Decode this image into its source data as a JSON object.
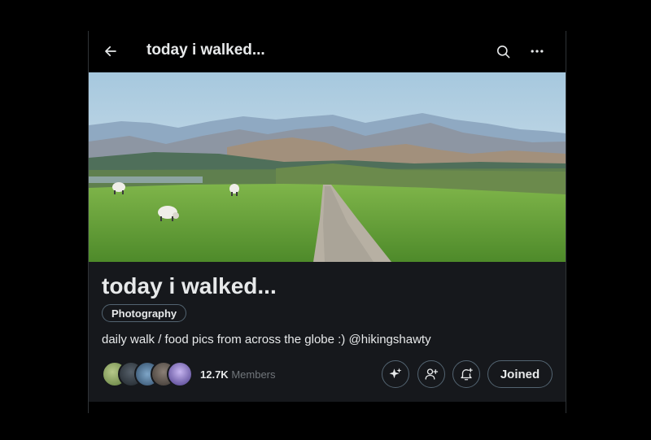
{
  "header": {
    "title": "today i walked...",
    "icons": {
      "back": "arrow-left-icon",
      "search": "search-icon",
      "more": "more-horizontal-icon"
    }
  },
  "banner": {
    "description": "banner-photo"
  },
  "community": {
    "name": "today i walked...",
    "tag": "Photography",
    "description": "daily walk / food pics from across the globe :) @hikingshawty",
    "members_count": "12.7K",
    "members_label": "Members"
  },
  "actions": {
    "grok_icon": "sparkle-icon",
    "invite_icon": "add-user-icon",
    "notifications_icon": "bell-plus-icon",
    "joined_label": "Joined"
  },
  "colors": {
    "background": "#000000",
    "card": "#16181c",
    "text": "#e7e9ea",
    "muted": "#71767b",
    "border": "#536471"
  }
}
